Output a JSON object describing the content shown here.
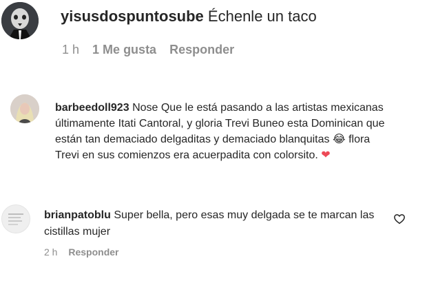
{
  "comments": [
    {
      "username": "yisusdospuntosube",
      "text": "Échenle un taco",
      "time": "1 h",
      "likes": "1 Me gusta",
      "reply": "Responder"
    },
    {
      "username": "barbeedoll923",
      "text": "Nose Que le está pasando a las artistas mexicanas últimamente Itati Cantoral, y gloria Trevi Buneo esta Dominican que están tan demaciado delgaditas y demaciado blanquitas 😂 flora Trevi en sus comienzos era acuerpadita con colorsito.",
      "emoji_end": "❤"
    },
    {
      "username": "brianpatoblu",
      "text": "Super bella, pero esas muy delgada se te marcan las cistillas mujer",
      "time": "2 h",
      "reply": "Responder"
    }
  ],
  "colors": {
    "text": "#262626",
    "meta": "#8e8e8e",
    "heart_red": "#ed4956"
  },
  "icons": {
    "like": "heart-outline-icon"
  }
}
